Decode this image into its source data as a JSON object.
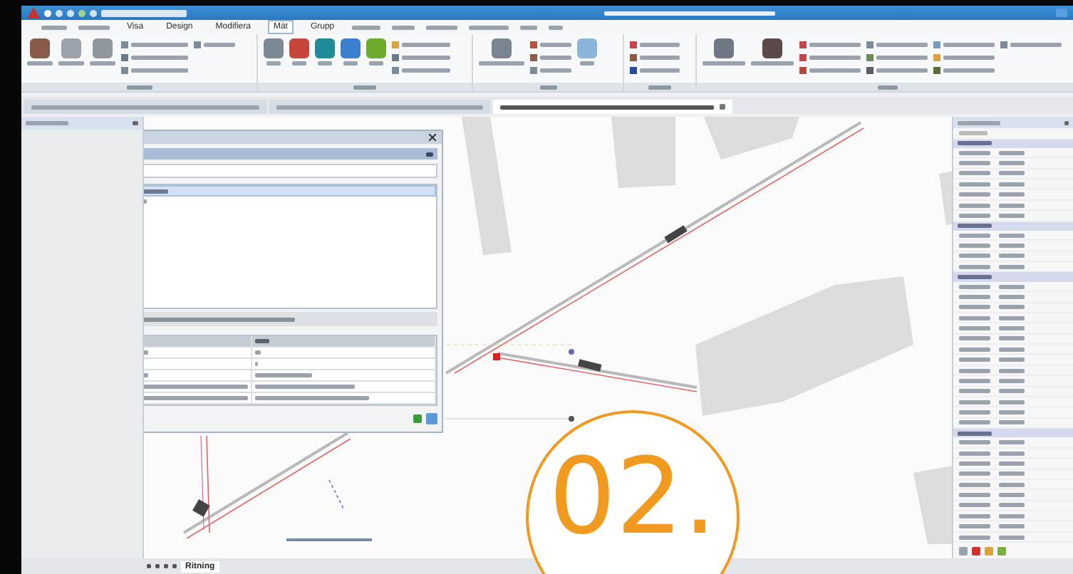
{
  "menu_tabs": [
    {
      "label": "Visa",
      "selected": false
    },
    {
      "label": "Design",
      "selected": false
    },
    {
      "label": "Modifiera",
      "selected": false
    },
    {
      "label": "Mät",
      "selected": true
    },
    {
      "label": "Grupp",
      "selected": false
    }
  ],
  "document_tabs": [
    {
      "selected": false
    },
    {
      "selected": false
    },
    {
      "selected": true
    }
  ],
  "sheet_tabs": [
    {
      "label": "Ritning",
      "selected": true
    }
  ],
  "overlay": {
    "label": "02."
  }
}
